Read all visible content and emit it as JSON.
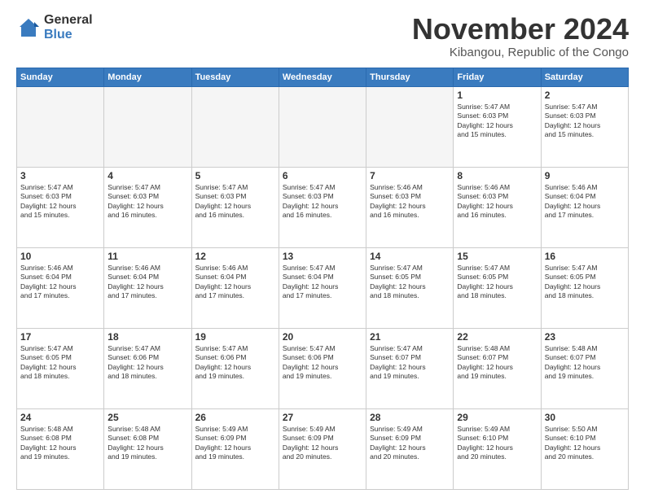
{
  "header": {
    "logo_general": "General",
    "logo_blue": "Blue",
    "month_title": "November 2024",
    "location": "Kibangou, Republic of the Congo"
  },
  "days_of_week": [
    "Sunday",
    "Monday",
    "Tuesday",
    "Wednesday",
    "Thursday",
    "Friday",
    "Saturday"
  ],
  "weeks": [
    [
      {
        "day": "",
        "info": ""
      },
      {
        "day": "",
        "info": ""
      },
      {
        "day": "",
        "info": ""
      },
      {
        "day": "",
        "info": ""
      },
      {
        "day": "",
        "info": ""
      },
      {
        "day": "1",
        "info": "Sunrise: 5:47 AM\nSunset: 6:03 PM\nDaylight: 12 hours\nand 15 minutes."
      },
      {
        "day": "2",
        "info": "Sunrise: 5:47 AM\nSunset: 6:03 PM\nDaylight: 12 hours\nand 15 minutes."
      }
    ],
    [
      {
        "day": "3",
        "info": "Sunrise: 5:47 AM\nSunset: 6:03 PM\nDaylight: 12 hours\nand 15 minutes."
      },
      {
        "day": "4",
        "info": "Sunrise: 5:47 AM\nSunset: 6:03 PM\nDaylight: 12 hours\nand 16 minutes."
      },
      {
        "day": "5",
        "info": "Sunrise: 5:47 AM\nSunset: 6:03 PM\nDaylight: 12 hours\nand 16 minutes."
      },
      {
        "day": "6",
        "info": "Sunrise: 5:47 AM\nSunset: 6:03 PM\nDaylight: 12 hours\nand 16 minutes."
      },
      {
        "day": "7",
        "info": "Sunrise: 5:46 AM\nSunset: 6:03 PM\nDaylight: 12 hours\nand 16 minutes."
      },
      {
        "day": "8",
        "info": "Sunrise: 5:46 AM\nSunset: 6:03 PM\nDaylight: 12 hours\nand 16 minutes."
      },
      {
        "day": "9",
        "info": "Sunrise: 5:46 AM\nSunset: 6:04 PM\nDaylight: 12 hours\nand 17 minutes."
      }
    ],
    [
      {
        "day": "10",
        "info": "Sunrise: 5:46 AM\nSunset: 6:04 PM\nDaylight: 12 hours\nand 17 minutes."
      },
      {
        "day": "11",
        "info": "Sunrise: 5:46 AM\nSunset: 6:04 PM\nDaylight: 12 hours\nand 17 minutes."
      },
      {
        "day": "12",
        "info": "Sunrise: 5:46 AM\nSunset: 6:04 PM\nDaylight: 12 hours\nand 17 minutes."
      },
      {
        "day": "13",
        "info": "Sunrise: 5:47 AM\nSunset: 6:04 PM\nDaylight: 12 hours\nand 17 minutes."
      },
      {
        "day": "14",
        "info": "Sunrise: 5:47 AM\nSunset: 6:05 PM\nDaylight: 12 hours\nand 18 minutes."
      },
      {
        "day": "15",
        "info": "Sunrise: 5:47 AM\nSunset: 6:05 PM\nDaylight: 12 hours\nand 18 minutes."
      },
      {
        "day": "16",
        "info": "Sunrise: 5:47 AM\nSunset: 6:05 PM\nDaylight: 12 hours\nand 18 minutes."
      }
    ],
    [
      {
        "day": "17",
        "info": "Sunrise: 5:47 AM\nSunset: 6:05 PM\nDaylight: 12 hours\nand 18 minutes."
      },
      {
        "day": "18",
        "info": "Sunrise: 5:47 AM\nSunset: 6:06 PM\nDaylight: 12 hours\nand 18 minutes."
      },
      {
        "day": "19",
        "info": "Sunrise: 5:47 AM\nSunset: 6:06 PM\nDaylight: 12 hours\nand 19 minutes."
      },
      {
        "day": "20",
        "info": "Sunrise: 5:47 AM\nSunset: 6:06 PM\nDaylight: 12 hours\nand 19 minutes."
      },
      {
        "day": "21",
        "info": "Sunrise: 5:47 AM\nSunset: 6:07 PM\nDaylight: 12 hours\nand 19 minutes."
      },
      {
        "day": "22",
        "info": "Sunrise: 5:48 AM\nSunset: 6:07 PM\nDaylight: 12 hours\nand 19 minutes."
      },
      {
        "day": "23",
        "info": "Sunrise: 5:48 AM\nSunset: 6:07 PM\nDaylight: 12 hours\nand 19 minutes."
      }
    ],
    [
      {
        "day": "24",
        "info": "Sunrise: 5:48 AM\nSunset: 6:08 PM\nDaylight: 12 hours\nand 19 minutes."
      },
      {
        "day": "25",
        "info": "Sunrise: 5:48 AM\nSunset: 6:08 PM\nDaylight: 12 hours\nand 19 minutes."
      },
      {
        "day": "26",
        "info": "Sunrise: 5:49 AM\nSunset: 6:09 PM\nDaylight: 12 hours\nand 19 minutes."
      },
      {
        "day": "27",
        "info": "Sunrise: 5:49 AM\nSunset: 6:09 PM\nDaylight: 12 hours\nand 20 minutes."
      },
      {
        "day": "28",
        "info": "Sunrise: 5:49 AM\nSunset: 6:09 PM\nDaylight: 12 hours\nand 20 minutes."
      },
      {
        "day": "29",
        "info": "Sunrise: 5:49 AM\nSunset: 6:10 PM\nDaylight: 12 hours\nand 20 minutes."
      },
      {
        "day": "30",
        "info": "Sunrise: 5:50 AM\nSunset: 6:10 PM\nDaylight: 12 hours\nand 20 minutes."
      }
    ]
  ]
}
